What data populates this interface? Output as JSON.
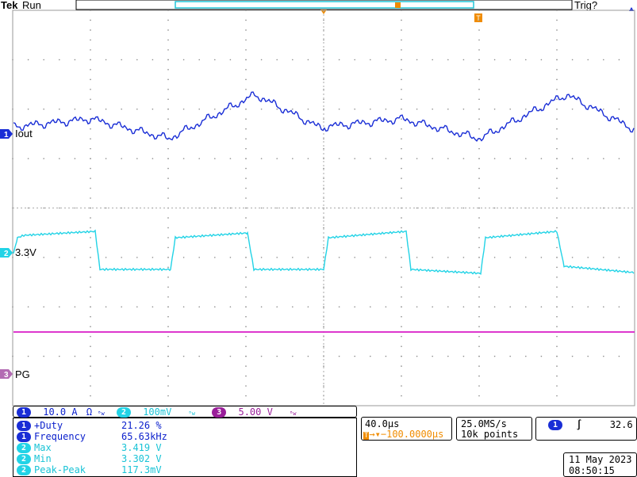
{
  "header": {
    "brand": "Tek",
    "mode": "Run",
    "trigger_status": "Trig?"
  },
  "channels": {
    "ch1": {
      "number": "1",
      "label": "Iout",
      "color": "#1a2ed6"
    },
    "ch2": {
      "number": "2",
      "label": "3.3V",
      "color": "#22d3e6"
    },
    "ch3": {
      "label": "PG",
      "color": "#d81bc7"
    }
  },
  "scales": {
    "ch1_num": "1",
    "ch1_scale": "10.0 A",
    "ch1_extra": "Ω",
    "ch2_num": "2",
    "ch2_scale": "100mV",
    "ch3_num": "3",
    "ch3_scale": "5.00 V"
  },
  "measurements": [
    {
      "ch": "1",
      "name": "+Duty",
      "value": "21.26 %"
    },
    {
      "ch": "1",
      "name": "Frequency",
      "value": "65.63kHz"
    },
    {
      "ch": "2",
      "name": "Max",
      "value": "3.419 V"
    },
    {
      "ch": "2",
      "name": "Min",
      "value": "3.302 V"
    },
    {
      "ch": "2",
      "name": "Peak-Peak",
      "value": "117.3mV"
    }
  ],
  "timebase": {
    "time_div": "40.0µs",
    "trigger_position": "100.0000µs",
    "sample_rate": "25.0MS/s",
    "record_length": "10k points"
  },
  "trigger": {
    "source": "1",
    "level": "32.6 A"
  },
  "datetime": {
    "date": "11 May 2023",
    "time": "08:50:15"
  }
}
